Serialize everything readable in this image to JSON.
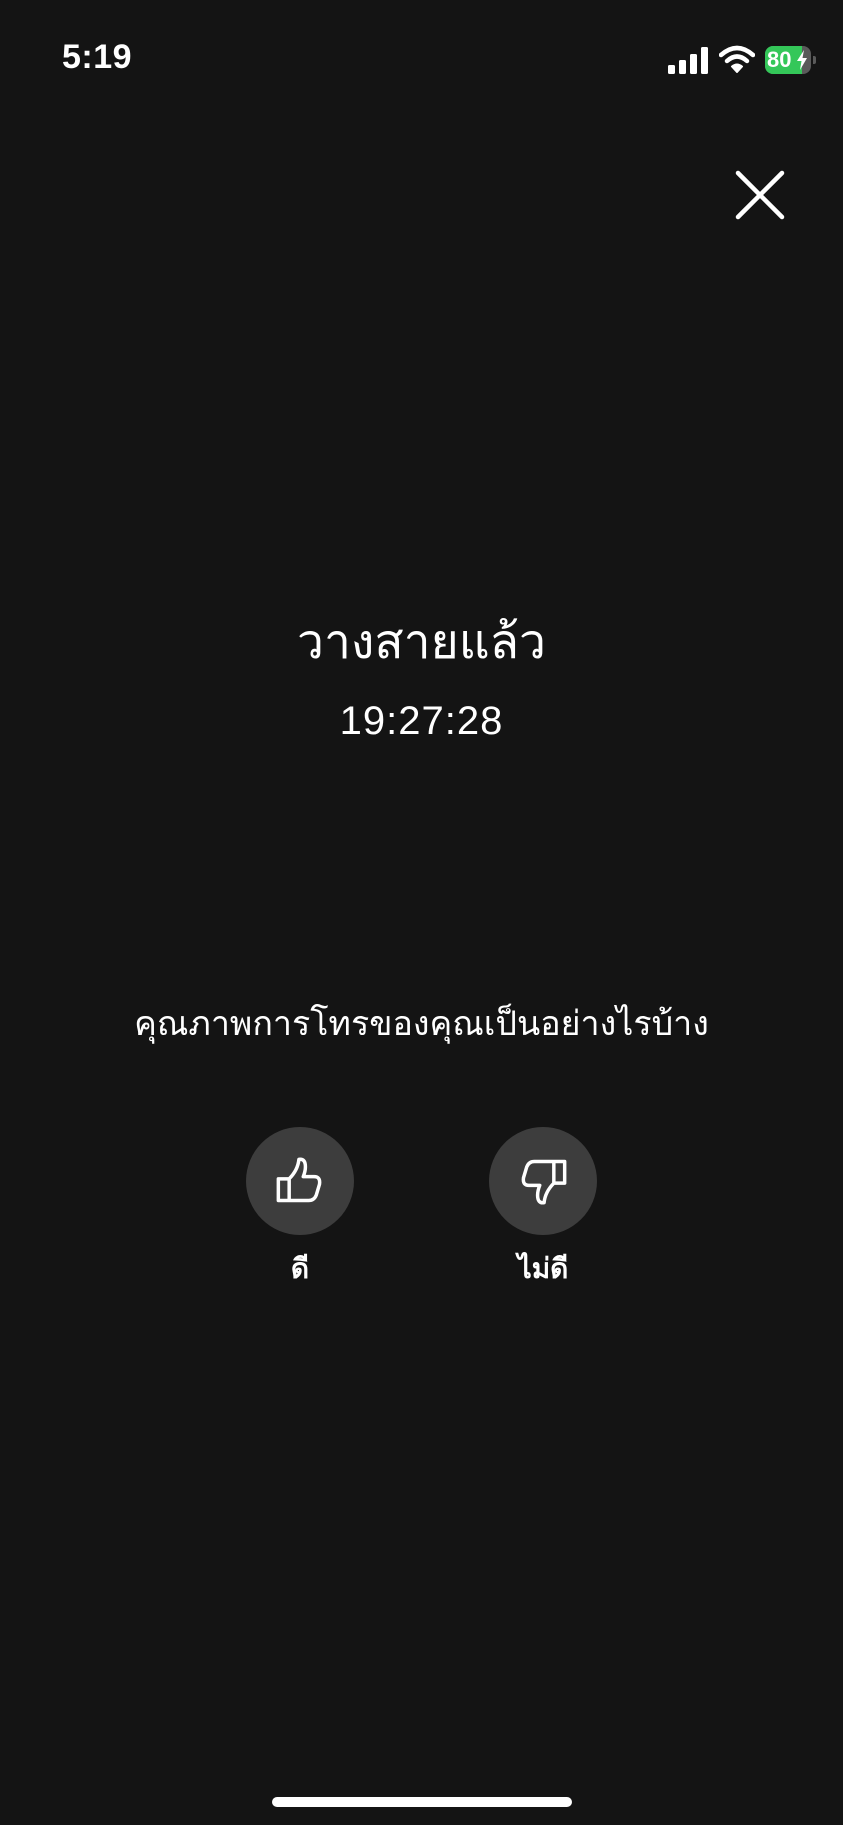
{
  "status_bar": {
    "time": "5:19",
    "battery_level": "80",
    "battery_percent": 80,
    "battery_charging": true,
    "battery_color": "#34c759"
  },
  "icons": {
    "signal": "signal-icon",
    "wifi": "wifi-icon",
    "battery": "battery-icon",
    "close": "close-icon",
    "thumbs_up": "thumbs-up-icon",
    "thumbs_down": "thumbs-down-icon"
  },
  "call": {
    "status_title": "วางสายแล้ว",
    "time": "19:27:28"
  },
  "feedback": {
    "question": "คุณภาพการโทรของคุณเป็นอย่างไรบ้าง",
    "good_label": "ดี",
    "bad_label": "ไม่ดี"
  },
  "colors": {
    "background": "#141414",
    "button_circle": "#3d3d3d",
    "text": "#ffffff"
  }
}
